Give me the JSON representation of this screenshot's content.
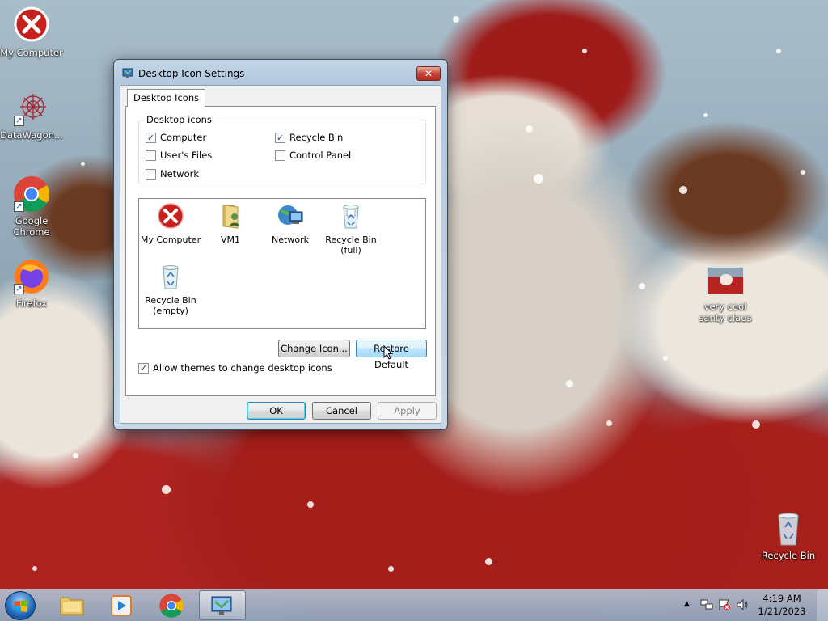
{
  "desktop": {
    "icons_left": [
      {
        "label": "My Computer",
        "icon": "red-error-x-icon"
      },
      {
        "label": "DataWagon...",
        "icon": "datawagon-icon"
      },
      {
        "label": "Google Chrome",
        "icon": "chrome-icon"
      },
      {
        "label": "Firefox",
        "icon": "firefox-icon"
      }
    ],
    "icon_right_image": {
      "label": "very cool santy claus",
      "icon": "image-thumbnail-icon"
    },
    "icon_recycle": {
      "label": "Recycle Bin",
      "icon": "recycle-bin-icon"
    }
  },
  "dialog": {
    "title": "Desktop Icon Settings",
    "close_label": "✕",
    "tab_label": "Desktop Icons",
    "group_label": "Desktop icons",
    "checkboxes": {
      "computer": {
        "label": "Computer",
        "checked": true
      },
      "recycle_bin": {
        "label": "Recycle Bin",
        "checked": true
      },
      "users_files": {
        "label": "User's Files",
        "checked": false
      },
      "control_panel": {
        "label": "Control Panel",
        "checked": false
      },
      "network": {
        "label": "Network",
        "checked": false
      }
    },
    "list_items": [
      {
        "label": "My Computer",
        "icon": "red-error-x-icon"
      },
      {
        "label": "VM1",
        "icon": "user-folder-icon"
      },
      {
        "label": "Network",
        "icon": "network-globe-icon"
      },
      {
        "label": "Recycle Bin (full)",
        "icon": "recycle-bin-full-icon"
      },
      {
        "label": "Recycle Bin (empty)",
        "icon": "recycle-bin-empty-icon"
      }
    ],
    "change_icon_label": "Change Icon...",
    "restore_default_label": "Restore Default",
    "allow_themes": {
      "label": "Allow themes to change desktop icons",
      "checked": true
    },
    "ok_label": "OK",
    "cancel_label": "Cancel",
    "apply_label": "Apply"
  },
  "taskbar": {
    "items": [
      "windows-explorer-icon",
      "media-player-icon",
      "chrome-icon",
      "desktop-settings-icon"
    ],
    "clock_time": "4:19 AM",
    "clock_date": "1/21/2023",
    "tray_icons": [
      "show-hidden-icons-arrow",
      "network-icon",
      "action-center-flag-icon",
      "volume-icon"
    ]
  },
  "colors": {
    "accent": "#3c7fb1",
    "close_red": "#c7453a"
  }
}
